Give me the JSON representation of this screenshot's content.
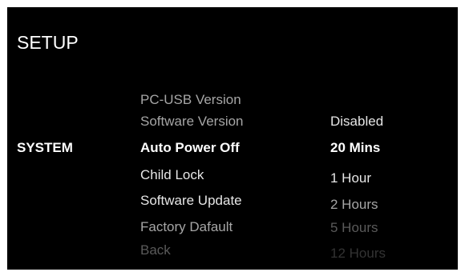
{
  "header": {
    "title": "SETUP"
  },
  "category": {
    "label": "SYSTEM"
  },
  "menu": {
    "items": [
      {
        "label": "PC-USB Version"
      },
      {
        "label": "Software Version"
      },
      {
        "label": "Auto Power Off",
        "selected": true
      },
      {
        "label": "Child Lock"
      },
      {
        "label": "Software Update"
      },
      {
        "label": "Factory Dafault"
      },
      {
        "label": "Back"
      }
    ]
  },
  "options": {
    "items": [
      {
        "label": "Disabled"
      },
      {
        "label": "20 Mins",
        "selected": true
      },
      {
        "label": "1 Hour"
      },
      {
        "label": "2 Hours"
      },
      {
        "label": "5 Hours"
      },
      {
        "label": "12 Hours"
      }
    ]
  },
  "colors": {
    "background": "#000000",
    "text_bright": "#ffffff",
    "text_normal": "#e6e6e6",
    "text_dim": "#a6a6a6",
    "text_faint": "#5a5a5a",
    "text_faintest": "#333333"
  }
}
